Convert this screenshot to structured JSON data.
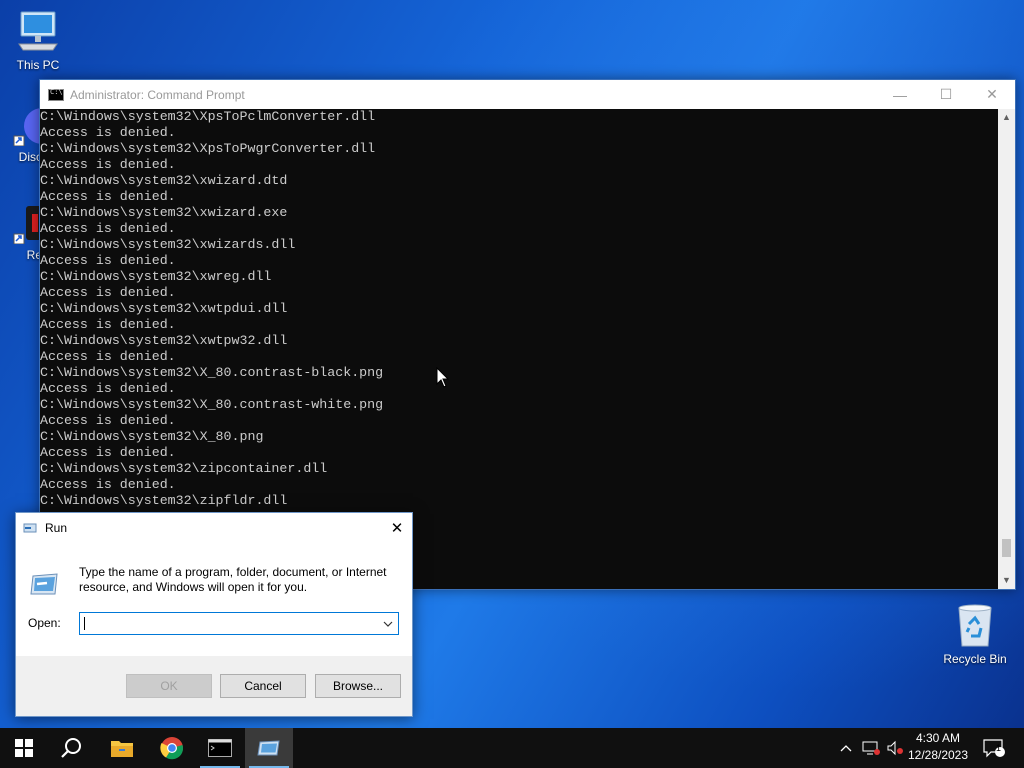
{
  "desktop": {
    "icons": [
      {
        "label": "This PC"
      },
      {
        "label": "Disc"
      },
      {
        "label": "Re"
      },
      {
        "label": "Recycle Bin"
      }
    ]
  },
  "cmd": {
    "title": "Administrator: Command Prompt",
    "lines": [
      "C:\\Windows\\system32\\XpsToPclmConverter.dll",
      "Access is denied.",
      "C:\\Windows\\system32\\XpsToPwgrConverter.dll",
      "Access is denied.",
      "C:\\Windows\\system32\\xwizard.dtd",
      "Access is denied.",
      "C:\\Windows\\system32\\xwizard.exe",
      "Access is denied.",
      "C:\\Windows\\system32\\xwizards.dll",
      "Access is denied.",
      "C:\\Windows\\system32\\xwreg.dll",
      "Access is denied.",
      "C:\\Windows\\system32\\xwtpdui.dll",
      "Access is denied.",
      "C:\\Windows\\system32\\xwtpw32.dll",
      "Access is denied.",
      "C:\\Windows\\system32\\X_80.contrast-black.png",
      "Access is denied.",
      "C:\\Windows\\system32\\X_80.contrast-white.png",
      "Access is denied.",
      "C:\\Windows\\system32\\X_80.png",
      "Access is denied.",
      "C:\\Windows\\system32\\zipcontainer.dll",
      "Access is denied.",
      "C:\\Windows\\system32\\zipfldr.dll"
    ],
    "minimize_glyph": "—",
    "maximize_glyph": "☐",
    "close_glyph": "✕"
  },
  "run": {
    "title": "Run",
    "description": "Type the name of a program, folder, document, or Internet resource, and Windows will open it for you.",
    "open_label": "Open:",
    "open_value": "",
    "ok_label": "OK",
    "cancel_label": "Cancel",
    "browse_label": "Browse...",
    "close_glyph": "✕"
  },
  "taskbar": {
    "time": "4:30 AM",
    "date": "12/28/2023",
    "notification_count": "1"
  },
  "colors": {
    "accent": "#0078d7",
    "console_bg": "#0c0c0c",
    "console_fg": "#cccccc",
    "taskbar_bg": "#101010"
  }
}
